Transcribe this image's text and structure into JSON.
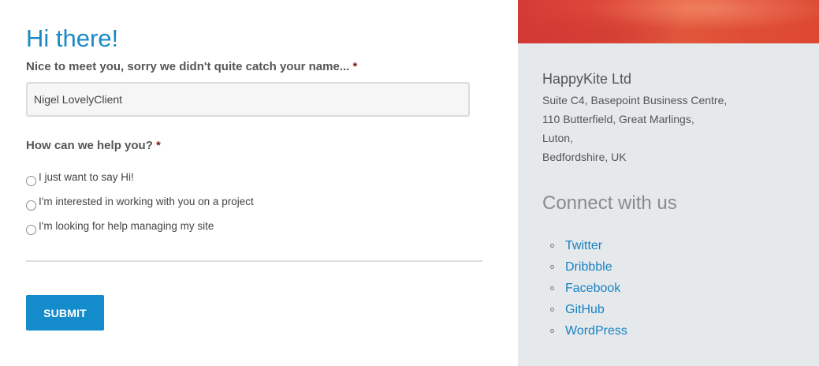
{
  "form": {
    "title": "Hi there!",
    "name_label": "Nice to meet you, sorry we didn't quite catch your name...",
    "required_mark": "*",
    "name_value": "Nigel LovelyClient",
    "help_label": "How can we help you?",
    "options": [
      "I just want to say Hi!",
      "I'm interested in working with you on a project",
      "I'm looking for help managing my site"
    ],
    "submit_label": "SUBMIT",
    "accent_color": "#148ccc"
  },
  "sidebar": {
    "banner_color": "#e04c3a",
    "company_name": "HappyKite Ltd",
    "address_lines": [
      "Suite C4, Basepoint Business Centre,",
      "110 Butterfield, Great Marlings,",
      "Luton,",
      "Bedfordshire, UK"
    ],
    "connect_title": "Connect with us",
    "social_links": [
      "Twitter",
      "Dribbble",
      "Facebook",
      "GitHub",
      "WordPress"
    ]
  }
}
